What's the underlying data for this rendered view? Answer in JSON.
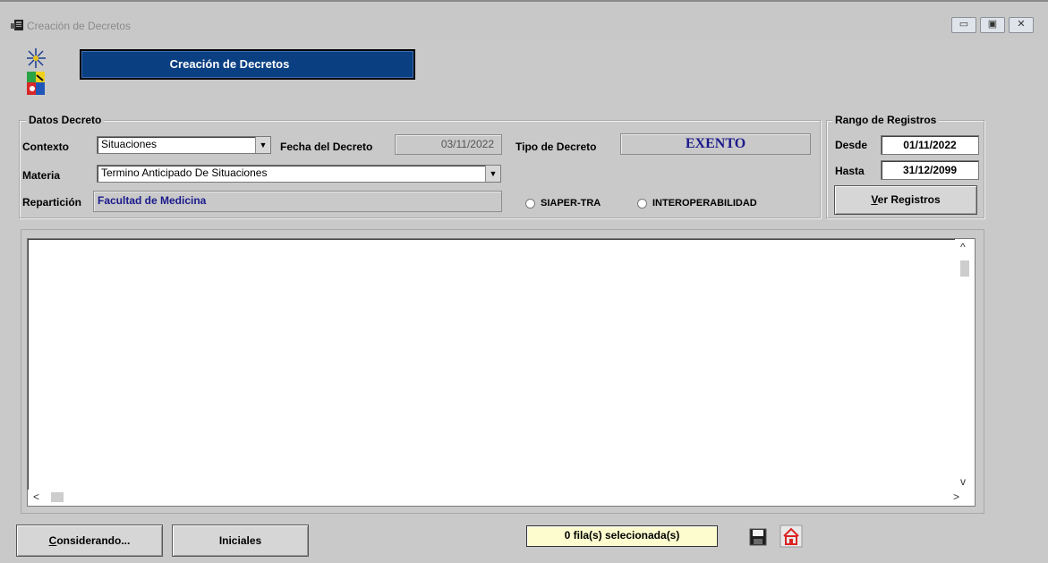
{
  "window": {
    "title": "Creación de Decretos",
    "controls": {
      "minimize": "▭",
      "restore": "▣",
      "close": "✕"
    }
  },
  "header": {
    "title": "Creación de Decretos"
  },
  "datos_decreto": {
    "legend": "Datos Decreto",
    "contexto": {
      "label": "Contexto",
      "value": "Situaciones"
    },
    "fecha": {
      "label": "Fecha del Decreto",
      "value": "03/11/2022"
    },
    "tipo": {
      "label": "Tipo de Decreto",
      "value": "EXENTO",
      "value_color": "#1a1a8c"
    },
    "materia": {
      "label": "Materia",
      "value": "Termino Anticipado De Situaciones"
    },
    "reparticion": {
      "label": "Repartición",
      "value": "Facultad de Medicina",
      "value_color": "#1a1a8c"
    },
    "radios": [
      {
        "label": "SIAPER-TRA",
        "checked": false
      },
      {
        "label": "INTEROPERABILIDAD",
        "checked": false
      }
    ]
  },
  "rango": {
    "legend": "Rango de Registros",
    "desde": {
      "label": "Desde",
      "value": "01/11/2022"
    },
    "hasta": {
      "label": "Hasta",
      "value": "31/12/2099"
    },
    "ver_button": {
      "accel": "V",
      "rest": "er Registros"
    }
  },
  "footer": {
    "considerando_button": {
      "accel": "C",
      "rest": "onsiderando..."
    },
    "iniciales_button": "Iniciales",
    "status": "0 fila(s) selecionada(s)",
    "icons": [
      "save-icon",
      "home-icon"
    ]
  }
}
